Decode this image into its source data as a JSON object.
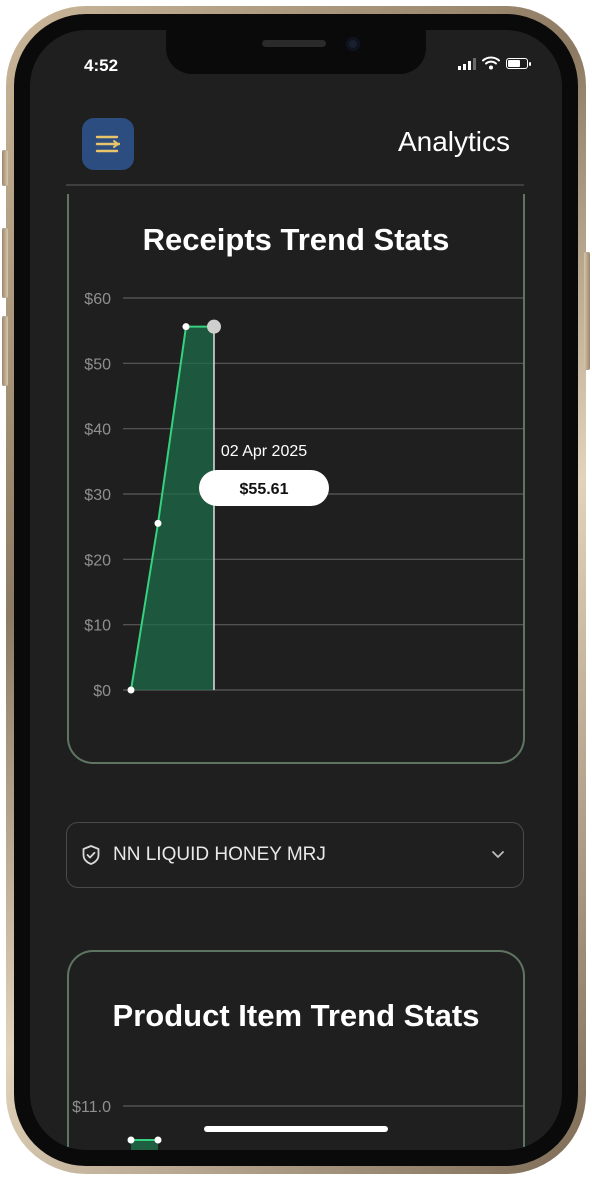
{
  "status_bar": {
    "time": "4:52"
  },
  "header": {
    "title": "Analytics"
  },
  "colors": {
    "background": "#1f1f1f",
    "menu_button": "#2b4d80",
    "menu_icon": "#e9c46a",
    "card_border": "#5e7563",
    "line": "#34d27e",
    "area_fill": "#1e6b48"
  },
  "icons": {
    "menu": "menu-lines-icon",
    "shield": "shield-check-icon",
    "chevron": "chevron-down-icon"
  },
  "receipts_card": {
    "title": "Receipts Trend Stats",
    "tooltip_date": "02 Apr 2025",
    "tooltip_value": "$55.61"
  },
  "product_dropdown": {
    "selected": "NN LIQUID HONEY MRJ"
  },
  "product_card": {
    "title": "Product Item Trend Stats"
  },
  "chart_data": [
    {
      "type": "area",
      "title": "Receipts Trend Stats",
      "y_tick_labels": [
        "$0",
        "$10",
        "$20",
        "$30",
        "$40",
        "$50",
        "$60"
      ],
      "y_ticks": [
        0,
        10,
        20,
        30,
        40,
        50,
        60
      ],
      "ylim": [
        0,
        60
      ],
      "grid": true,
      "series": [
        {
          "values": [
            0,
            25.5,
            55.61,
            55.61
          ]
        }
      ],
      "highlight": {
        "index": 3,
        "label": "02 Apr 2025",
        "value_label": "$55.61"
      }
    },
    {
      "type": "area",
      "title": "Product Item Trend Stats",
      "y_tick_labels": [
        "$11.0"
      ],
      "y_ticks": [
        11.0
      ],
      "grid": true,
      "series": [
        {
          "values": [
            10.5,
            10.5
          ]
        }
      ]
    }
  ]
}
